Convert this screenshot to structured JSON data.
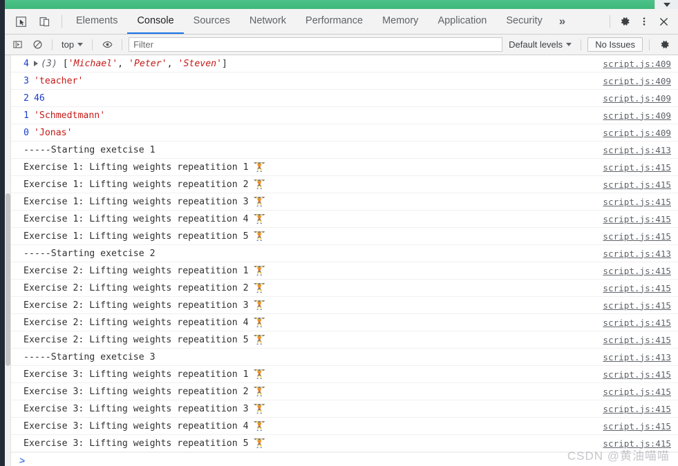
{
  "page_header": {
    "accent_color": "#42bd7c",
    "dropdown_icon": "caret-down-icon"
  },
  "tabbar": {
    "inspect_icon": "inspect-element-icon",
    "device_icon": "device-toolbar-icon",
    "tabs": [
      {
        "label": "Elements",
        "active": false
      },
      {
        "label": "Console",
        "active": true
      },
      {
        "label": "Sources",
        "active": false
      },
      {
        "label": "Network",
        "active": false
      },
      {
        "label": "Performance",
        "active": false
      },
      {
        "label": "Memory",
        "active": false
      },
      {
        "label": "Application",
        "active": false
      },
      {
        "label": "Security",
        "active": false
      }
    ],
    "more_tabs_label": "»",
    "settings_icon": "gear-icon",
    "menu_icon": "kebab-menu-icon",
    "close_icon": "close-icon"
  },
  "filterbar": {
    "sidebar_icon": "console-sidebar-icon",
    "clear_icon": "clear-console-icon",
    "context_label": "top",
    "eye_icon": "live-expression-icon",
    "filter_placeholder": "Filter",
    "filter_value": "",
    "levels_label": "Default levels",
    "issues_label": "No Issues",
    "settings_icon": "gear-icon"
  },
  "console": {
    "rows": [
      {
        "index": "4",
        "expandable": true,
        "kind": "array",
        "array_meta": "(3)",
        "items": [
          "'Michael'",
          "'Peter'",
          "'Steven'"
        ],
        "source": "script.js:409"
      },
      {
        "index": "3",
        "expandable": false,
        "kind": "string",
        "text": "'teacher'",
        "source": "script.js:409"
      },
      {
        "index": "2",
        "expandable": false,
        "kind": "number",
        "text": "46",
        "source": "script.js:409"
      },
      {
        "index": "1",
        "expandable": false,
        "kind": "string",
        "text": "'Schmedtmann'",
        "source": "script.js:409"
      },
      {
        "index": "0",
        "expandable": false,
        "kind": "string",
        "text": "'Jonas'",
        "source": "script.js:409"
      },
      {
        "index": "",
        "expandable": false,
        "kind": "plain",
        "text": "-----Starting exetcise 1",
        "source": "script.js:413"
      },
      {
        "index": "",
        "expandable": false,
        "kind": "plain",
        "text": "Exercise 1: Lifting weights repeatition 1",
        "emoji": "🏋",
        "source": "script.js:415"
      },
      {
        "index": "",
        "expandable": false,
        "kind": "plain",
        "text": "Exercise 1: Lifting weights repeatition 2",
        "emoji": "🏋",
        "source": "script.js:415"
      },
      {
        "index": "",
        "expandable": false,
        "kind": "plain",
        "text": "Exercise 1: Lifting weights repeatition 3",
        "emoji": "🏋",
        "source": "script.js:415"
      },
      {
        "index": "",
        "expandable": false,
        "kind": "plain",
        "text": "Exercise 1: Lifting weights repeatition 4",
        "emoji": "🏋",
        "source": "script.js:415"
      },
      {
        "index": "",
        "expandable": false,
        "kind": "plain",
        "text": "Exercise 1: Lifting weights repeatition 5",
        "emoji": "🏋",
        "source": "script.js:415"
      },
      {
        "index": "",
        "expandable": false,
        "kind": "plain",
        "text": "-----Starting exetcise 2",
        "source": "script.js:413"
      },
      {
        "index": "",
        "expandable": false,
        "kind": "plain",
        "text": "Exercise 2: Lifting weights repeatition 1",
        "emoji": "🏋",
        "source": "script.js:415"
      },
      {
        "index": "",
        "expandable": false,
        "kind": "plain",
        "text": "Exercise 2: Lifting weights repeatition 2",
        "emoji": "🏋",
        "source": "script.js:415"
      },
      {
        "index": "",
        "expandable": false,
        "kind": "plain",
        "text": "Exercise 2: Lifting weights repeatition 3",
        "emoji": "🏋",
        "source": "script.js:415"
      },
      {
        "index": "",
        "expandable": false,
        "kind": "plain",
        "text": "Exercise 2: Lifting weights repeatition 4",
        "emoji": "🏋",
        "source": "script.js:415"
      },
      {
        "index": "",
        "expandable": false,
        "kind": "plain",
        "text": "Exercise 2: Lifting weights repeatition 5",
        "emoji": "🏋",
        "source": "script.js:415"
      },
      {
        "index": "",
        "expandable": false,
        "kind": "plain",
        "text": "-----Starting exetcise 3",
        "source": "script.js:413"
      },
      {
        "index": "",
        "expandable": false,
        "kind": "plain",
        "text": "Exercise 3: Lifting weights repeatition 1",
        "emoji": "🏋",
        "source": "script.js:415"
      },
      {
        "index": "",
        "expandable": false,
        "kind": "plain",
        "text": "Exercise 3: Lifting weights repeatition 2",
        "emoji": "🏋",
        "source": "script.js:415"
      },
      {
        "index": "",
        "expandable": false,
        "kind": "plain",
        "text": "Exercise 3: Lifting weights repeatition 3",
        "emoji": "🏋",
        "source": "script.js:415"
      },
      {
        "index": "",
        "expandable": false,
        "kind": "plain",
        "text": "Exercise 3: Lifting weights repeatition 4",
        "emoji": "🏋",
        "source": "script.js:415"
      },
      {
        "index": "",
        "expandable": false,
        "kind": "plain",
        "text": "Exercise 3: Lifting weights repeatition 5",
        "emoji": "🏋",
        "source": "script.js:415"
      }
    ],
    "prompt_caret": ">"
  },
  "watermark": {
    "text": "CSDN @黄油喵喵"
  }
}
